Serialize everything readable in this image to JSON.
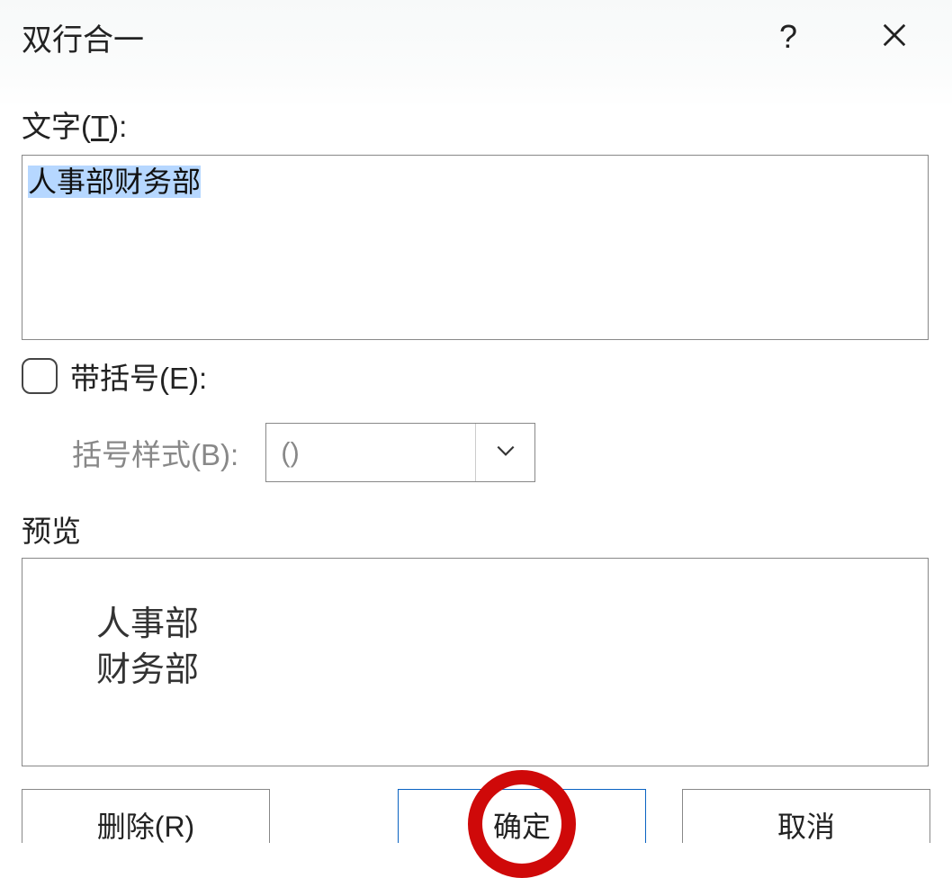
{
  "dialog": {
    "title": "双行合一",
    "help": "?"
  },
  "text_section": {
    "label_prefix": "文字(",
    "label_hotkey": "T",
    "label_suffix": "):",
    "value": "人事部财务部"
  },
  "bracket_section": {
    "checkbox_label_prefix": "带括号(",
    "checkbox_hotkey": "E",
    "checkbox_label_suffix": "):",
    "style_label_prefix": "括号样式(",
    "style_hotkey": "B",
    "style_label_suffix": "):",
    "style_value": "()"
  },
  "preview": {
    "label": "预览",
    "line1": "人事部",
    "line2": "财务部"
  },
  "buttons": {
    "remove": "删除(R)",
    "ok": "确定",
    "cancel": "取消"
  }
}
